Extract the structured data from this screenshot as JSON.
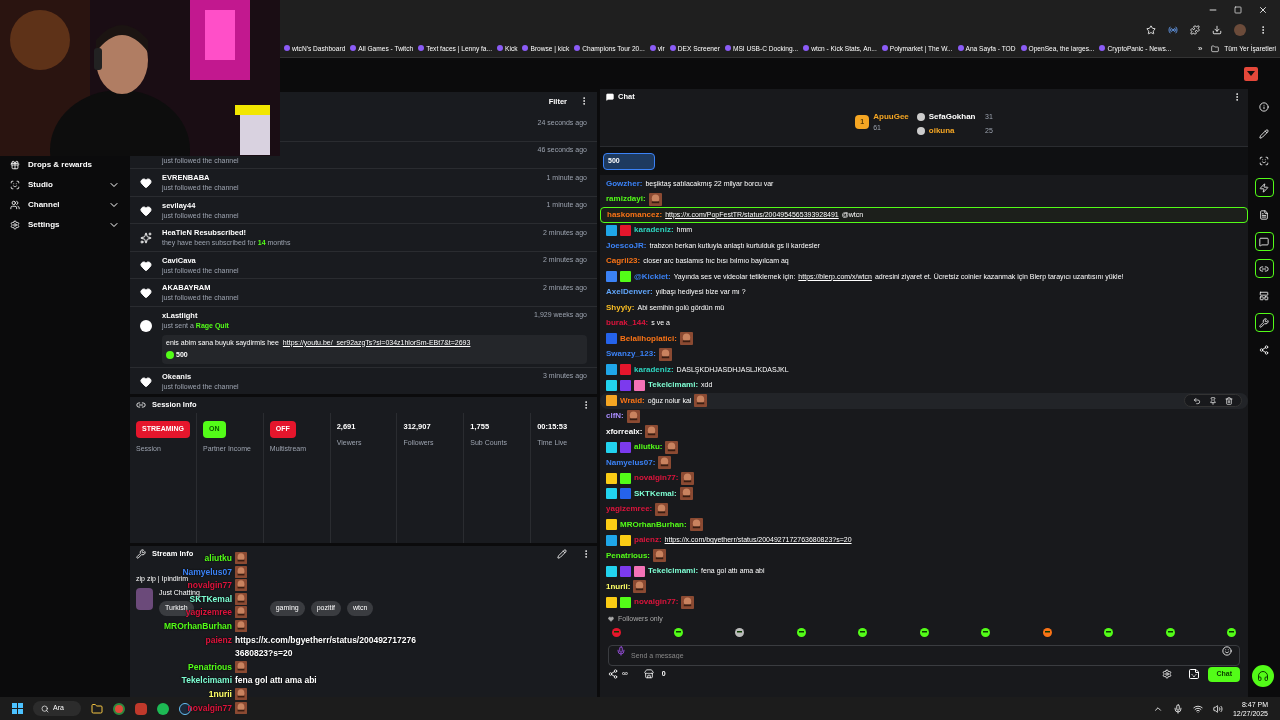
{
  "bookmarks": [
    "wtcN's Dashboard",
    "All Games - Twitch",
    "Text faces | Lenny fa...",
    "Kick",
    "Browse | kick",
    "Champions Tour 20...",
    "vlr",
    "DEX Screener",
    "MSI USB-C Docking...",
    "wtcn - Kick Stats, An...",
    "Polymarket | The W...",
    "Ana Sayfa - TOD",
    "OpenSea, the larges...",
    "CryptoPanic - News..."
  ],
  "more_bookmarks": "»",
  "all_bookmarks": "Tüm Yer İşaretleri",
  "sidebar": [
    {
      "label": "Drops & rewards",
      "expandable": false
    },
    {
      "label": "Studio",
      "expandable": true
    },
    {
      "label": "Channel",
      "expandable": true
    },
    {
      "label": "Settings",
      "expandable": true
    }
  ],
  "activity": {
    "filter": "Filter",
    "items": [
      {
        "time": "24 seconds ago"
      },
      {
        "detail": "just followed the channel",
        "time": "46 seconds ago"
      },
      {
        "kind": "follow",
        "name": "EVRENBABA",
        "detail": "just followed the channel",
        "time": "1 minute ago"
      },
      {
        "kind": "follow",
        "name": "sevilay44",
        "detail": "just followed the channel",
        "time": "1 minute ago"
      },
      {
        "kind": "resub",
        "name": "HeaTieN Resubscribed!",
        "detail": "they have been subscribed for **14** months",
        "time": "2 minutes ago"
      },
      {
        "kind": "follow",
        "name": "CaviCava",
        "detail": "just followed the channel",
        "time": "2 minutes ago"
      },
      {
        "kind": "follow",
        "name": "AKABAYRAM",
        "detail": "just followed the channel",
        "time": "2 minutes ago"
      },
      {
        "kind": "gift",
        "name": "xLastlight",
        "detail": "just sent a **Rage Quit**",
        "time": "1,929 weeks ago",
        "message": "enis abim sana buyuk saydirmis hee",
        "link": "https://youtu.be/_ser92azgTs?si=034z1hlorSm-EBt7&t=2693",
        "amount": "500"
      },
      {
        "kind": "follow",
        "name": "Okeanis",
        "detail": "just followed the channel",
        "time": "3 minutes ago"
      }
    ]
  },
  "session": {
    "title": "Session Info",
    "items": [
      {
        "kind": "badge",
        "value": "STREAMING",
        "color": "#e5162c",
        "label": "Session"
      },
      {
        "kind": "badge",
        "value": "ON",
        "color": "#53fc18",
        "label": "Partner Income"
      },
      {
        "kind": "badge",
        "value": "OFF",
        "color": "#e5162c",
        "label": "Multistream"
      },
      {
        "kind": "stat",
        "value": "2,691",
        "label": "Viewers"
      },
      {
        "kind": "stat",
        "value": "312,907",
        "label": "Followers"
      },
      {
        "kind": "stat",
        "value": "1,755",
        "label": "Sub Counts"
      },
      {
        "kind": "stat",
        "value": "00:15:53",
        "label": "Time Live"
      }
    ]
  },
  "stream_info": {
    "title": "Stream Info",
    "stream_title": "zip zip | Ipindirim",
    "category": "Just Chatting",
    "tags": [
      "Turkish",
      "gaming",
      "pozitif",
      "wtcn"
    ]
  },
  "overlay_chat": [
    {
      "user": "aliutku",
      "color": "#53fc18",
      "emote": true
    },
    {
      "user": "Namyelus07",
      "color": "#3b82f6",
      "emote": true
    },
    {
      "user": "novalgin77",
      "color": "#dc143c",
      "emote": true
    },
    {
      "user": "SKTKemal",
      "color": "#7fffd4",
      "emote": true
    },
    {
      "user": "yagizemree",
      "color": "#dc143c",
      "emote": true
    },
    {
      "user": "MROrhanBurhan",
      "color": "#53fc18",
      "emote": true
    },
    {
      "user": "paienz",
      "color": "#dc143c",
      "text": "https://x.com/bgyetherr/status/200492717276 3680823?s=20",
      "emote": false
    },
    {
      "user": "Penatrious",
      "color": "#53fc18",
      "emote": true
    },
    {
      "user": "Tekelcimami",
      "color": "#7fffd4",
      "text": "fena gol attı ama abi",
      "emote": false
    },
    {
      "user": "1nurii",
      "color": "#ffff66",
      "emote": true
    },
    {
      "user": "novalgin77",
      "color": "#dc143c",
      "emote": true
    }
  ],
  "chat": {
    "title": "Chat",
    "leaders": [
      {
        "rank": "1",
        "name": "ApuuGee",
        "count": "61",
        "color": "#f5a623"
      },
      {
        "name": "SefaGokhan",
        "count": "31",
        "color": "#ffffff"
      },
      {
        "name": "oikuna",
        "count": "25",
        "color": "#f5a623"
      }
    ],
    "pinned": "500",
    "messages": [
      {
        "user": "Gowzher:",
        "color": "#3b82f6",
        "text": "beşiktaş satılacakmış 22 milyar borcu var"
      },
      {
        "user": "ramizdayi:",
        "color": "#53fc18",
        "emote": true
      },
      {
        "user": "haskomancez:",
        "color": "#f97316",
        "link": "https://x.com/PopFestTR/status/2004954565393928491",
        "after": "@wtcn",
        "highlighted": true
      },
      {
        "user": "karadeniz:",
        "color": "#2dd4bf",
        "badges": [
          {
            "color": "#1fa6e8"
          },
          {
            "color": "#e5162c"
          }
        ],
        "text": "hmm"
      },
      {
        "user": "JoescoJR:",
        "color": "#3b82f6",
        "text": "trabzon berkan kutluyla anlaştı kurtulduk gs li kardesler"
      },
      {
        "user": "Cagril23:",
        "color": "#f97316",
        "text": "closer arc baslamıs hıc bısı bılmıo bayılcam aq"
      },
      {
        "user": "@Kicklet:",
        "color": "#3b82f6",
        "badges": [
          {
            "color": "#3b82f6"
          },
          {
            "color": "#53fc18"
          }
        ],
        "text": "Yayında ses ve videolar tetiklemek için:",
        "link": "https://blerp.com/x/wtcn",
        "after": "adresini ziyaret et. Ücretsiz coinler kazanmak için Blerp tarayıcı uzantısını yükle!"
      },
      {
        "user": "AxelDenver:",
        "color": "#60a5fa",
        "text": "yılbaşı hediyesi bize var mı ?"
      },
      {
        "user": "Shyyly:",
        "color": "#fbbf24",
        "text": "Abi semihin golü gördün mü"
      },
      {
        "user": "burak_144:",
        "color": "#dc143c",
        "text": "s ve a"
      },
      {
        "user": "Belalihoplatici:",
        "color": "#f97316",
        "badges": [
          {
            "color": "#2563eb"
          }
        ],
        "emote": true
      },
      {
        "user": "Swanzy_123:",
        "color": "#3b82f6",
        "emote": true
      },
      {
        "user": "karadeniz:",
        "color": "#2dd4bf",
        "badges": [
          {
            "color": "#1fa6e8"
          },
          {
            "color": "#e5162c"
          }
        ],
        "text": "DASLŞKDHJASDHJASLJKDASJKL"
      },
      {
        "user": "Tekelcimami:",
        "color": "#7fffd4",
        "badges": [
          {
            "color": "#22d3ee"
          },
          {
            "color": "#7c3aed"
          },
          {
            "color": "#f472b6"
          }
        ],
        "text": "xdd"
      },
      {
        "user": "Wraid:",
        "color": "#f97316",
        "badges": [
          {
            "color": "#f5a623"
          }
        ],
        "text": "oğuz nolur kal",
        "emote": true,
        "hovered": true
      },
      {
        "user": "clfN:",
        "color": "#a78bfa",
        "emote": true
      },
      {
        "user": "xforrealx:",
        "color": "#ffffff",
        "emote": true
      },
      {
        "user": "aliutku:",
        "color": "#53fc18",
        "badges": [
          {
            "color": "#22d3ee"
          },
          {
            "color": "#7c3aed"
          }
        ],
        "emote": true
      },
      {
        "user": "Namyelus07:",
        "color": "#3b82f6",
        "emote": true
      },
      {
        "user": "novalgin77:",
        "color": "#dc143c",
        "badges": [
          {
            "color": "#facc15"
          },
          {
            "color": "#53fc18"
          }
        ],
        "emote": true
      },
      {
        "user": "SKTKemal:",
        "color": "#7fffd4",
        "badges": [
          {
            "color": "#22d3ee"
          },
          {
            "color": "#2563eb"
          }
        ],
        "emote": true
      },
      {
        "user": "yagizemree:",
        "color": "#dc143c",
        "emote": true
      },
      {
        "user": "MROrhanBurhan:",
        "color": "#53fc18",
        "badges": [
          {
            "color": "#facc15"
          }
        ],
        "emote": true
      },
      {
        "user": "paienz:",
        "color": "#dc143c",
        "badges": [
          {
            "color": "#1fa6e8"
          },
          {
            "color": "#facc15"
          }
        ],
        "link": "https://x.com/bgyetherr/status/2004927172763680823?s=20"
      },
      {
        "user": "Penatrious:",
        "color": "#53fc18",
        "emote": true
      },
      {
        "user": "Tekelcimami:",
        "color": "#7fffd4",
        "badges": [
          {
            "color": "#22d3ee"
          },
          {
            "color": "#7c3aed"
          },
          {
            "color": "#f472b6"
          }
        ],
        "text": "fena gol attı ama abi"
      },
      {
        "user": "1nurii:",
        "color": "#ffff66",
        "emote": true
      },
      {
        "user": "novalgin77:",
        "color": "#dc143c",
        "badges": [
          {
            "color": "#facc15"
          },
          {
            "color": "#53fc18"
          }
        ],
        "emote": true
      }
    ],
    "mode": "Followers only",
    "placeholder": "Send a message",
    "points": "∞",
    "store_count": "0",
    "send": "Chat"
  },
  "taskbar": {
    "search": "Ara",
    "time": "8:47 PM",
    "date": "12/27/2025"
  }
}
